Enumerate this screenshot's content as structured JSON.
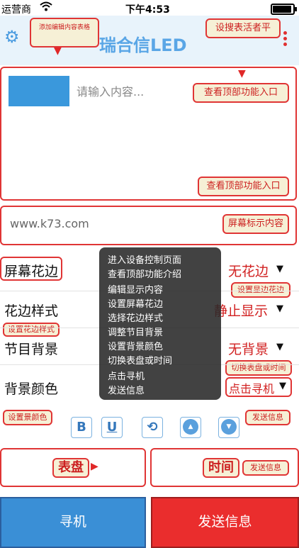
{
  "status_bar": {
    "carrier": "运营商",
    "wifi_icon": "wifi-icon",
    "time": "下午4:53"
  },
  "header": {
    "title": "瑞合信LED",
    "settings_icon": "gear-icon",
    "menu_icon": "menu-dots-icon"
  },
  "text_area": {
    "placeholder": "请输入内容..."
  },
  "url": "www.k73.com",
  "rows": [
    {
      "label": "屏幕花边",
      "value": "无花边"
    },
    {
      "label": "花边样式",
      "value": "静止显示"
    },
    {
      "label": "节目背景",
      "value": "无背景"
    },
    {
      "label": "背景颜色",
      "value": "点击寻机"
    }
  ],
  "format_buttons": {
    "bold": "B",
    "underline": "U",
    "rotate_icon": "rotate-icon",
    "up_icon": "arrow-up-icon",
    "down_icon": "arrow-down-icon"
  },
  "bottom_labels": {
    "left": "表盘",
    "right": "时间"
  },
  "buttons": {
    "find": "寻机",
    "send": "发送信息"
  },
  "overlay_menu": [
    "进入设备控制页面",
    "查看顶部功能介绍",
    "编辑显示内容",
    "设置屏幕花边",
    "选择花边样式",
    "调整节目背景",
    "设置背景颜色",
    "切换表盘或时间",
    "点击寻机",
    "发送信息"
  ],
  "callouts": {
    "top_left": "添加编辑内容表格",
    "top_right": "设搜表活者平",
    "check_top_1": "查看顶部功能入口",
    "check_top_2": "查看顶部功能入口",
    "screen_content": "屏幕标示内容",
    "set_border": "设置显边花边",
    "set_border_style": "设置花边样式",
    "switch": "切换表盘或时间",
    "set_bg_color": "设置景颜色",
    "send_info_1": "发送信息",
    "send_info_2": "发送信息"
  },
  "colors": {
    "accent_blue": "#3a8fd6",
    "accent_red": "#ea2d2d",
    "callout_bg": "#f6f0d6"
  }
}
